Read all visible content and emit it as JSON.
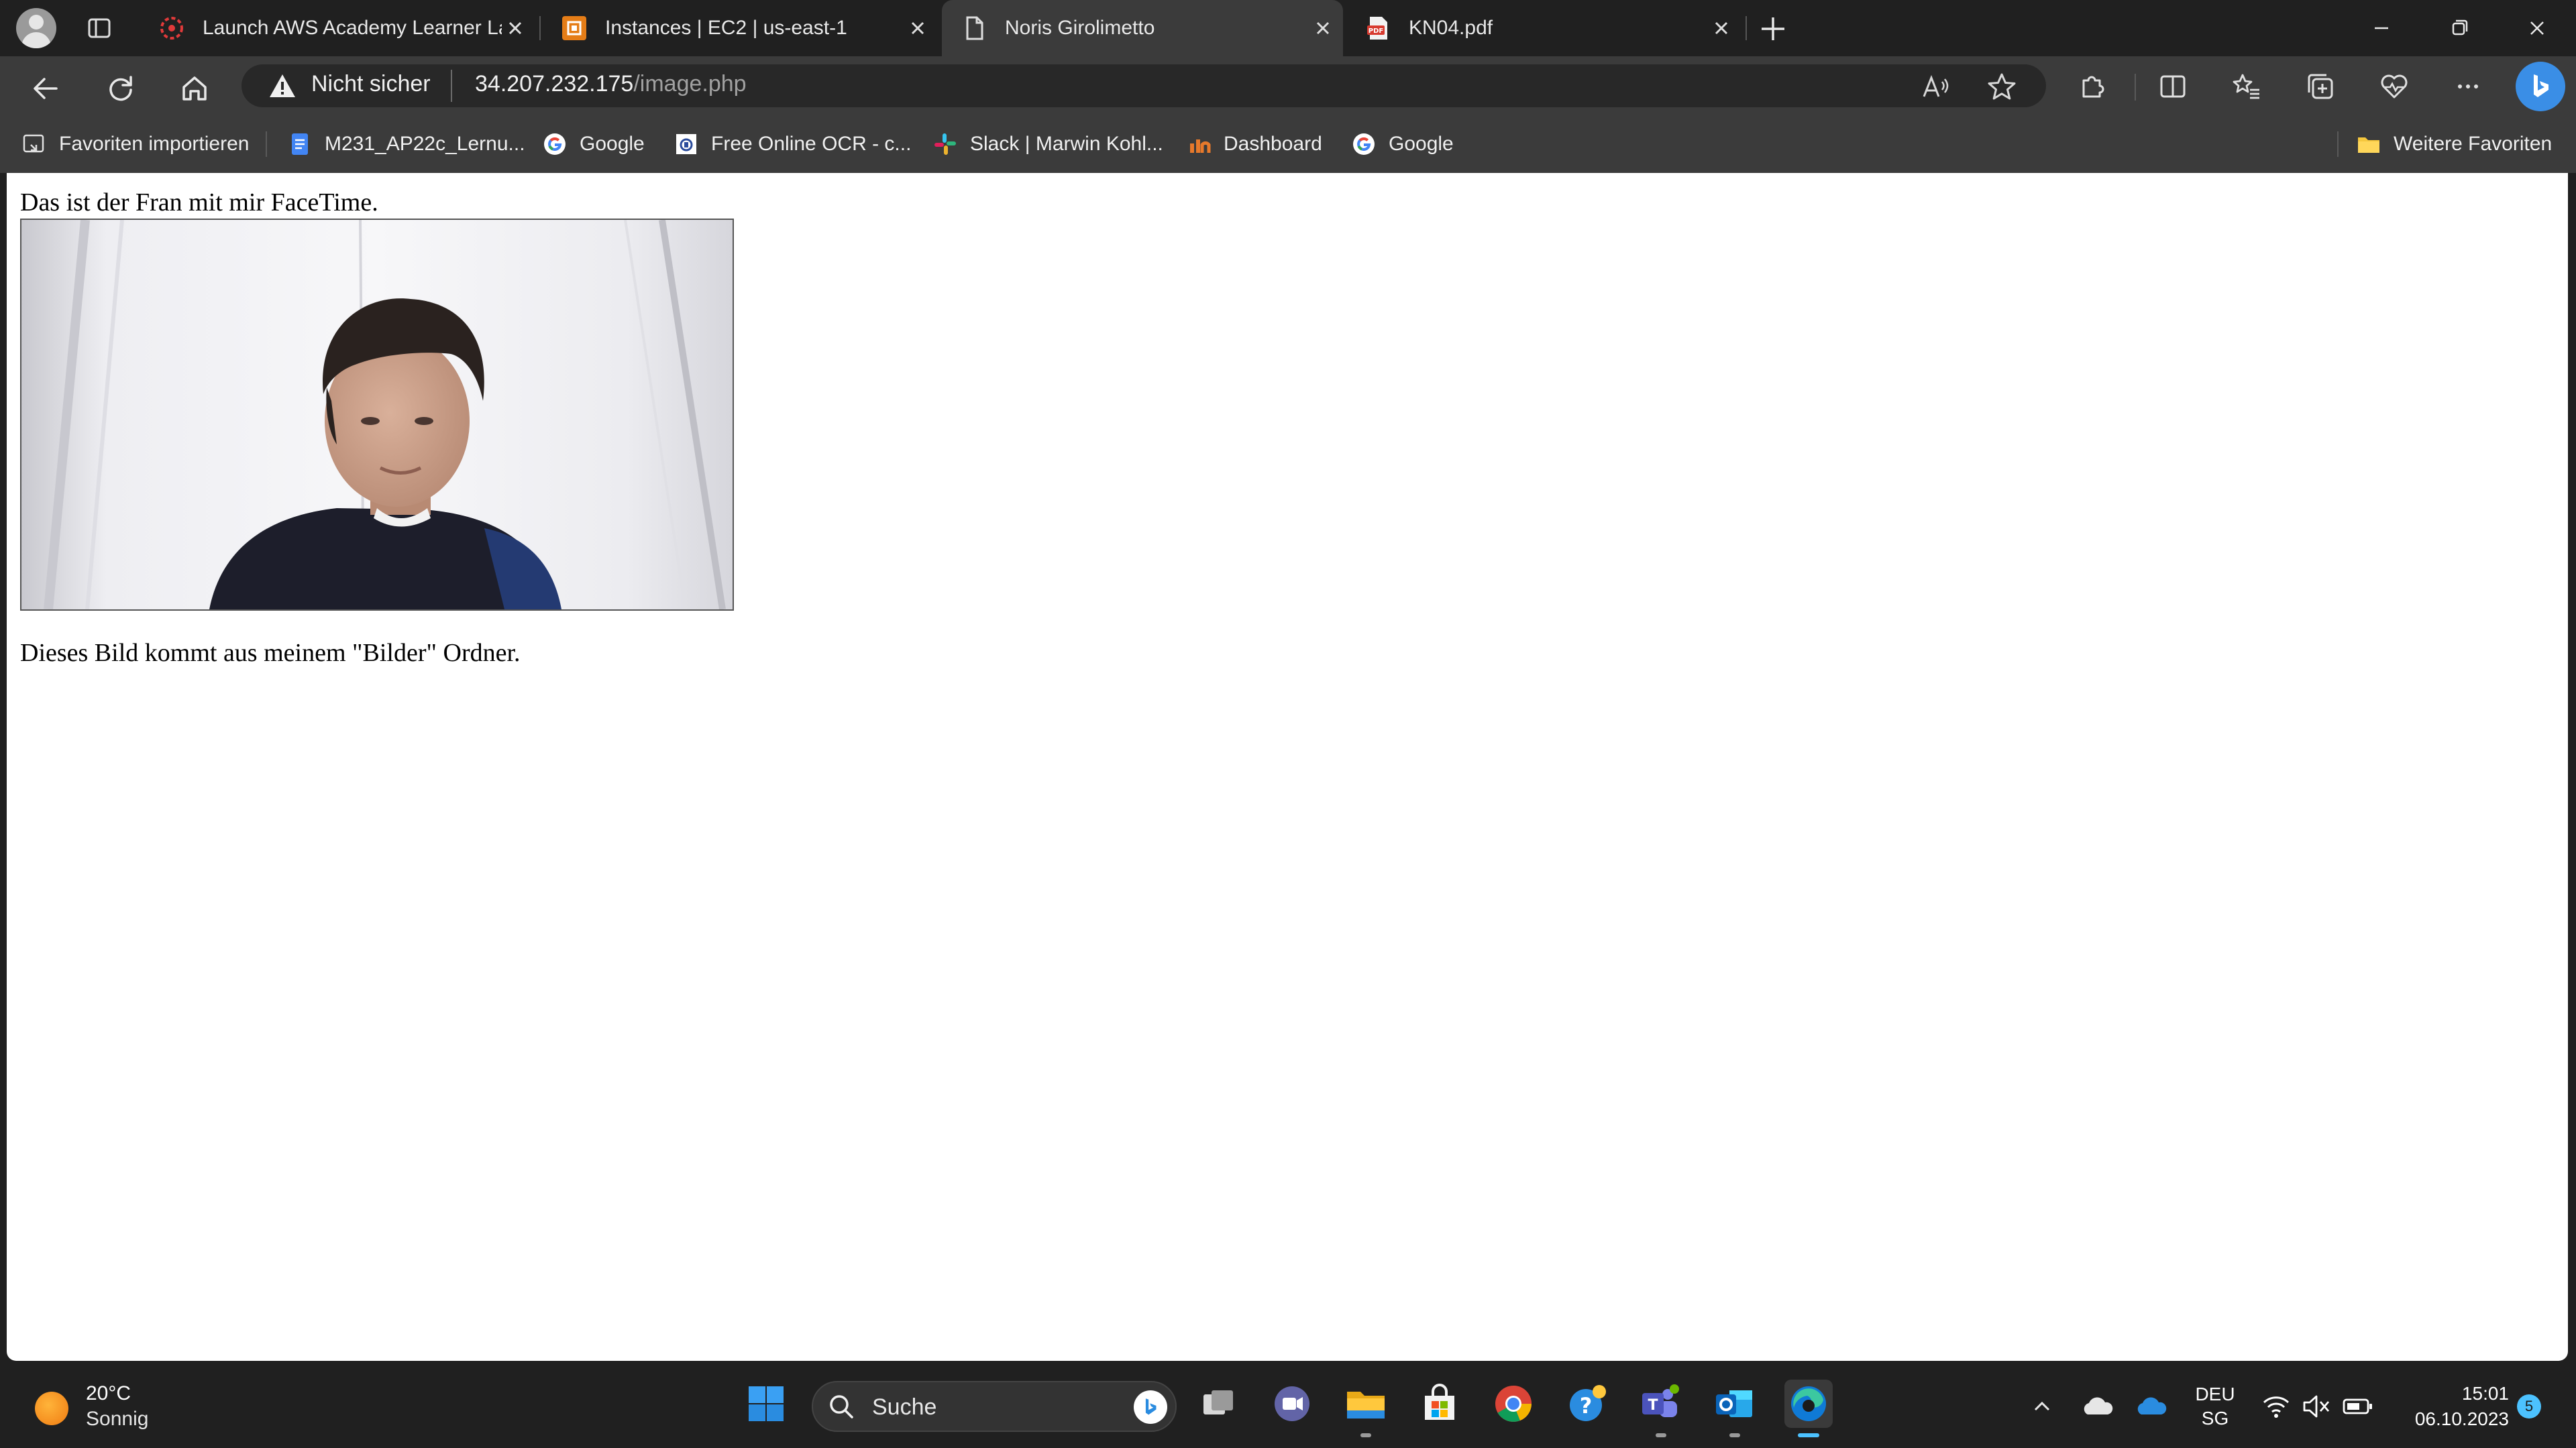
{
  "tabs": [
    {
      "title": "Launch AWS Academy Learner La",
      "favicon": "aws-academy-icon"
    },
    {
      "title": "Instances | EC2 | us-east-1",
      "favicon": "ec2-icon"
    },
    {
      "title": "Noris Girolimetto",
      "favicon": "page-icon",
      "active": true
    },
    {
      "title": "KN04.pdf",
      "favicon": "pdf-icon"
    }
  ],
  "address": {
    "security_label": "Nicht sicher",
    "host": "34.207.232.175",
    "path": "/image.php"
  },
  "bookmarks": {
    "items": [
      {
        "label": "Favoriten importieren",
        "icon": "import-favorites-icon"
      },
      {
        "label": "M231_AP22c_Lernu...",
        "icon": "docs-icon"
      },
      {
        "label": "Google",
        "icon": "google-icon"
      },
      {
        "label": "Free Online OCR - c...",
        "icon": "ocr-icon"
      },
      {
        "label": "Slack | Marwin Kohl...",
        "icon": "slack-icon"
      },
      {
        "label": "Dashboard",
        "icon": "dashboard-icon"
      },
      {
        "label": "Google",
        "icon": "google-icon"
      }
    ],
    "more_label": "Weitere Favoriten"
  },
  "page": {
    "line1": "Das ist der Fran mit mir FaceTime.",
    "line2": "Dieses Bild kommt aus meinem \"Bilder\" Ordner."
  },
  "taskbar": {
    "weather_temp": "20°C",
    "weather_desc": "Sonnig",
    "search_placeholder": "Suche",
    "lang_top": "DEU",
    "lang_bottom": "SG",
    "time": "15:01",
    "date": "06.10.2023",
    "notification_count": "5"
  },
  "colors": {
    "accent": "#3a8ee6",
    "chrome_dark": "#202020",
    "chrome_mid": "#3b3b3b"
  }
}
